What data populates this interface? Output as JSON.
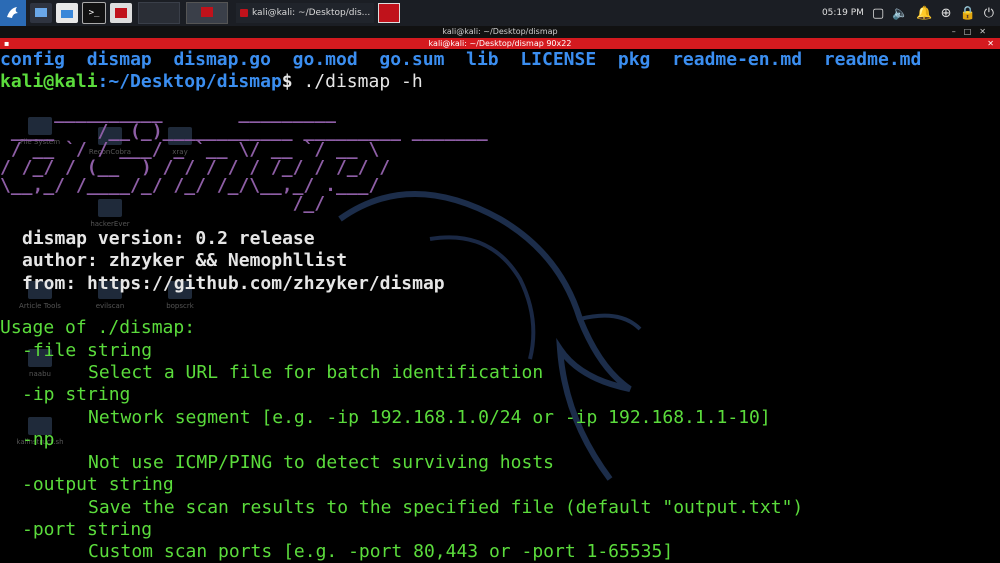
{
  "panel": {
    "clock": "05:19 PM",
    "task_title": "kali@kali: ~/Desktop/dis..."
  },
  "window": {
    "title": "kali@kali: ~/Desktop/dismap",
    "tab_title": "kali@kali: ~/Desktop/dismap 90x22"
  },
  "desktop": {
    "icons": [
      "File System",
      "ReconCobra",
      "xray",
      "hackerEver",
      "kalinstruct.sh",
      "Article Tools",
      "evilscan",
      "bopscrk",
      "naabu"
    ]
  },
  "terminal": {
    "ls_items": [
      "config",
      "dismap",
      "dismap.go",
      "go.mod",
      "go.sum",
      "lib",
      "LICENSE",
      "pkg",
      "readme-en.md",
      "readme.md"
    ],
    "prompt_user": "kali@kali",
    "prompt_path": ":~/Desktop/dismap",
    "prompt_symbol": "$",
    "command": " ./dismap -h",
    "banner": [
      "     __________       _________ ",
      " ____    /__(_)____________ _________ _______ ",
      " / __ `/ / ___/ _ `__ \\/ __ `/ __ \\",
      "/ /_/ / (__  ) / / / / / /_/ / /_/ /",
      "\\__,_/ /____/_/ /_/ /_/\\__,_/ .___/",
      "                           /_/"
    ],
    "version": "dismap version: 0.2 release",
    "author": "author: zhzyker && Nemophllist",
    "from": "from: https://github.com/zhzyker/dismap",
    "usage": "Usage of ./dismap:",
    "options": [
      {
        "flag": "-file string",
        "desc": "Select a URL file for batch identification"
      },
      {
        "flag": "-ip string",
        "desc": "Network segment [e.g. -ip 192.168.1.0/24 or -ip 192.168.1.1-10]"
      },
      {
        "flag": "-np",
        "desc": "Not use ICMP/PING to detect surviving hosts"
      },
      {
        "flag": "-output string",
        "desc": "Save the scan results to the specified file (default \"output.txt\")"
      },
      {
        "flag": "-port string",
        "desc": "Custom scan ports [e.g. -port 80,443 or -port 1-65535]"
      }
    ]
  }
}
